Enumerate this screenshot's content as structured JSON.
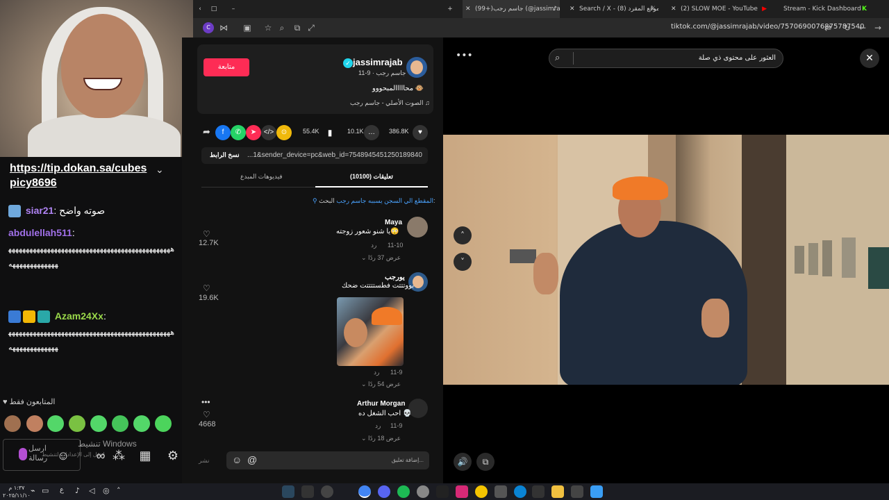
{
  "browser": {
    "tabs": [
      {
        "label": "(99+)جاسم رجب (@jassimrajab",
        "active": true
      },
      {
        "label": "Search / X - موقع المقرد (8)"
      },
      {
        "label": "(2) SLOW MOE - YouTube"
      },
      {
        "label": "Stream - Kick Dashboard"
      }
    ],
    "url": "tiktok.com/@jassimrajab/video/7570690076875787540"
  },
  "chat": {
    "link": "https://tip.dokan.sa/cubespicy8696",
    "messages": [
      {
        "user": "siar21",
        "text": "صوته واضح",
        "user_color": "#b084f5"
      },
      {
        "user": "abdulellah511",
        "text": "ههههههههههههههههههههههههههههههههههههههههههههههههههههههههههههه",
        "user_color": "#a070e8"
      },
      {
        "user": "Azam24Xx",
        "text": "ههههههههههههههههههههههههههههههههههههههههههههههههههههههههههههه",
        "user_color": "#9ad94a"
      }
    ],
    "followers_only": "المتابعون فقط",
    "send_placeholder": "ارسل رسالة",
    "windows_activate": "تنشيط Windows",
    "windows_activate_sub": "انتقل إلى الإعدادات لتنشيط Windows."
  },
  "tiktok": {
    "follow_label": "متابعة",
    "username": "jassimrajab",
    "display_sub": "جاسم رجب · 9-11",
    "caption": "محااااالمبحووو 🐵",
    "sound": "الصوت الأصلي - جاسم رجب",
    "likes": "386.8K",
    "comments": "10.1K",
    "saves": "55.4K",
    "copy_link": "نسخ الرابط",
    "link_text": "...1&sender_device=pc&web_id=7548945451250189840",
    "tab_comments": "تعليقات (10100)",
    "tab_videos": "فيديوهات المبدع",
    "search_hint_label": "البحث:",
    "search_hint": "المقطع الي السجن يسببه جاسم رجب",
    "comment_list": [
      {
        "author": "Maya",
        "text": "يا شنو شعور زوجته😳",
        "date": "11-10",
        "reply": "رد",
        "view_replies": "عرض 37 ردًا",
        "likes": "12.7K"
      },
      {
        "author": "يورجب",
        "text": "بووتتتت فطستتتتت ضحك",
        "date": "11-9",
        "reply": "رد",
        "view_replies": "عرض 54 ردًا",
        "likes": "19.6K"
      },
      {
        "author": "Arthur Morgan",
        "text": "احب الشغل ده 💀",
        "date": "11-9",
        "reply": "رد",
        "view_replies": "عرض 18 ردًا",
        "likes": "4668"
      }
    ],
    "add_comment": "إضافة تعليق...",
    "post_label": "نشر"
  },
  "video": {
    "search_placeholder": "العثور على محتوى ذي صلة"
  },
  "taskbar": {
    "date": "٢٠٢٥/١١/١٠",
    "time": "١:٣٧ م",
    "lang": "ع"
  }
}
